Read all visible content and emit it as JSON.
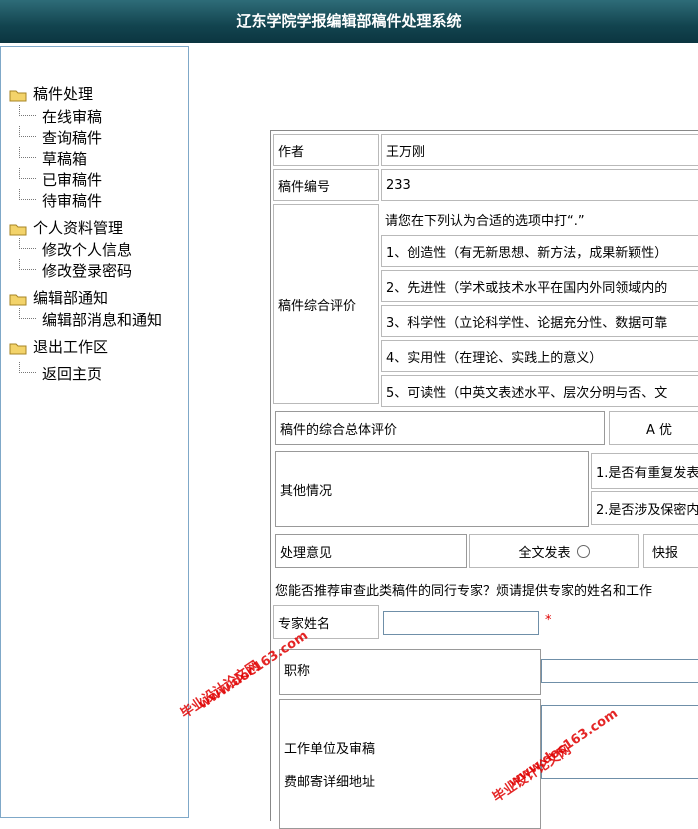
{
  "header": {
    "title": "辽东学院学报编辑部稿件处理系统"
  },
  "sidebar": {
    "groups": [
      {
        "label": "稿件处理",
        "items": [
          "在线审稿",
          "查询稿件",
          "草稿箱",
          "已审稿件",
          "待审稿件"
        ]
      },
      {
        "label": "个人资料管理",
        "items": [
          "修改个人信息",
          "修改登录密码"
        ]
      },
      {
        "label": "编辑部通知",
        "items": [
          "编辑部消息和通知"
        ]
      },
      {
        "label": "退出工作区",
        "items": [
          "返回主页"
        ]
      }
    ]
  },
  "form": {
    "author_label": "作者",
    "author_value": "王万刚",
    "id_label": "稿件编号",
    "id_value": "233",
    "eval_label": "稿件综合评价",
    "eval_instruction": "请您在下列认为合适的选项中打“.”",
    "criteria": [
      "1、创造性（有无新思想、新方法，成果新颖性）",
      "2、先进性（学术或技术水平在国内外同领域内的",
      "3、科学性（立论科学性、论据充分性、数据可靠",
      "4、实用性（在理论、实践上的意义）",
      "5、可读性（中英文表述水平、层次分明与否、文"
    ],
    "overall_label": "稿件的综合总体评价",
    "overall_option": "A 优",
    "other_label": "其他情况",
    "other_items": [
      "1.是否有重复发表",
      "2.是否涉及保密内"
    ],
    "opinion_label": "处理意见",
    "opinion_option_1": "全文发表",
    "opinion_option_2": "快报",
    "recommend_text": "您能否推荐审查此类稿件的同行专家？烦请提供专家的姓名和工作",
    "expert_name_label": "专家姓名",
    "required_mark": "*",
    "title_label": "职称",
    "address_label_1": "工作单位及审稿",
    "address_label_2": "费邮寄详细地址"
  },
  "watermarks": [
    "毕业设计论文网",
    "www.doc163.com"
  ],
  "colors": {
    "header_bg": "#1a4f5a",
    "sidebar_border": "#7fa8c8",
    "required": "#e00000"
  }
}
